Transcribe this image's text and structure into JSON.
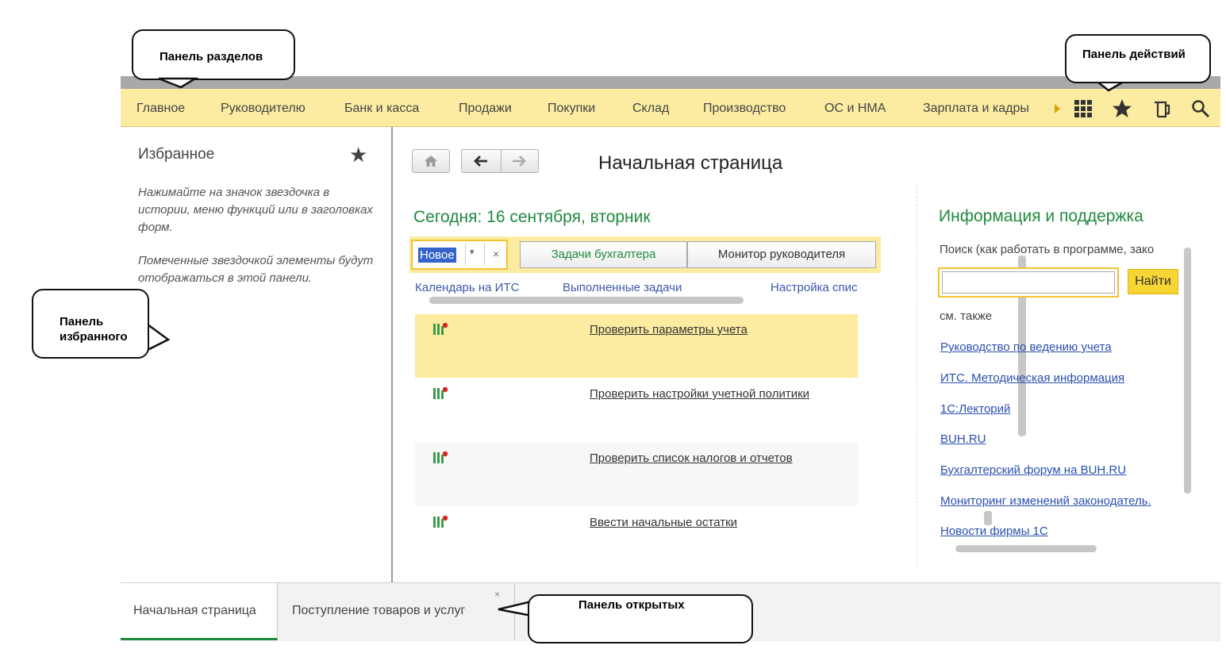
{
  "callouts": {
    "sections": "Панель разделов",
    "actions": "Панель действий",
    "favorites": "Панель избранного",
    "open": "Панель открытых"
  },
  "sections": [
    "Главное",
    "Руководителю",
    "Банк и касса",
    "Продажи",
    "Покупки",
    "Склад",
    "Производство",
    "ОС и НМА",
    "Зарплата и кадры"
  ],
  "actions_icons": [
    "grid-icon",
    "star-icon",
    "history-icon",
    "search-icon"
  ],
  "favorites": {
    "title": "Избранное",
    "hint1": "Нажимайте на значок звездочка в истории, меню функций или в заголовках форм.",
    "hint2": "Помеченные звездочкой элементы будут отображаться в этой панели."
  },
  "main": {
    "title": "Начальная страница",
    "today": "Сегодня: 16 сентября, вторник",
    "filter_value": "Новое",
    "tabs": [
      "Задачи бухгалтера",
      "Монитор руководителя"
    ],
    "links": [
      "Календарь на ИТС",
      "Выполненные задачи",
      "Настройка спис"
    ],
    "tasks": [
      "Проверить параметры учета",
      "Проверить настройки учетной политики",
      "Проверить список налогов и отчетов",
      "Ввести начальные остатки"
    ]
  },
  "info": {
    "title": "Информация и поддержка",
    "search_label": "Поиск (как работать в программе, зако",
    "find_button": "Найти",
    "see_also": "см. также",
    "links": [
      "Руководство по ведению учета",
      "ИТС. Методическая информация",
      "1С:Лекторий",
      "BUH.RU",
      "Бухгалтерский форум на BUH.RU",
      "Мониторинг изменений законодатель.",
      "Новости фирмы 1С"
    ]
  },
  "open_tabs": [
    "Начальная страница",
    "Поступление товаров и услуг"
  ],
  "colors": {
    "section_bar": "#fbeca1",
    "accent_green": "#1f8a3e",
    "link_blue": "#2a4fb0",
    "highlight": "#fbeca1"
  }
}
